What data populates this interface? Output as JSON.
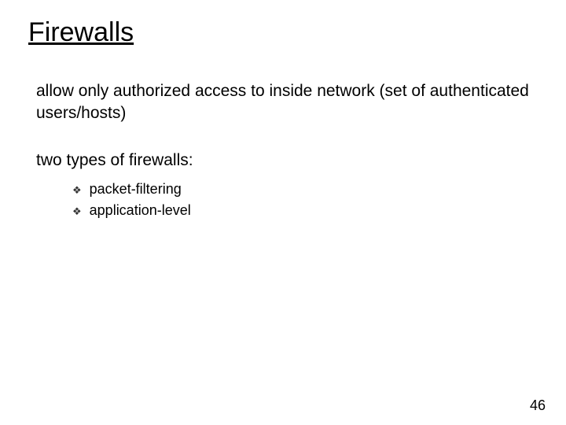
{
  "title": "Firewalls",
  "para1": "allow only authorized access to inside network (set of authenticated users/hosts)",
  "para2": "two types of firewalls:",
  "bullets": {
    "item0": "packet-filtering",
    "item1": "application-level"
  },
  "page_number": "46"
}
